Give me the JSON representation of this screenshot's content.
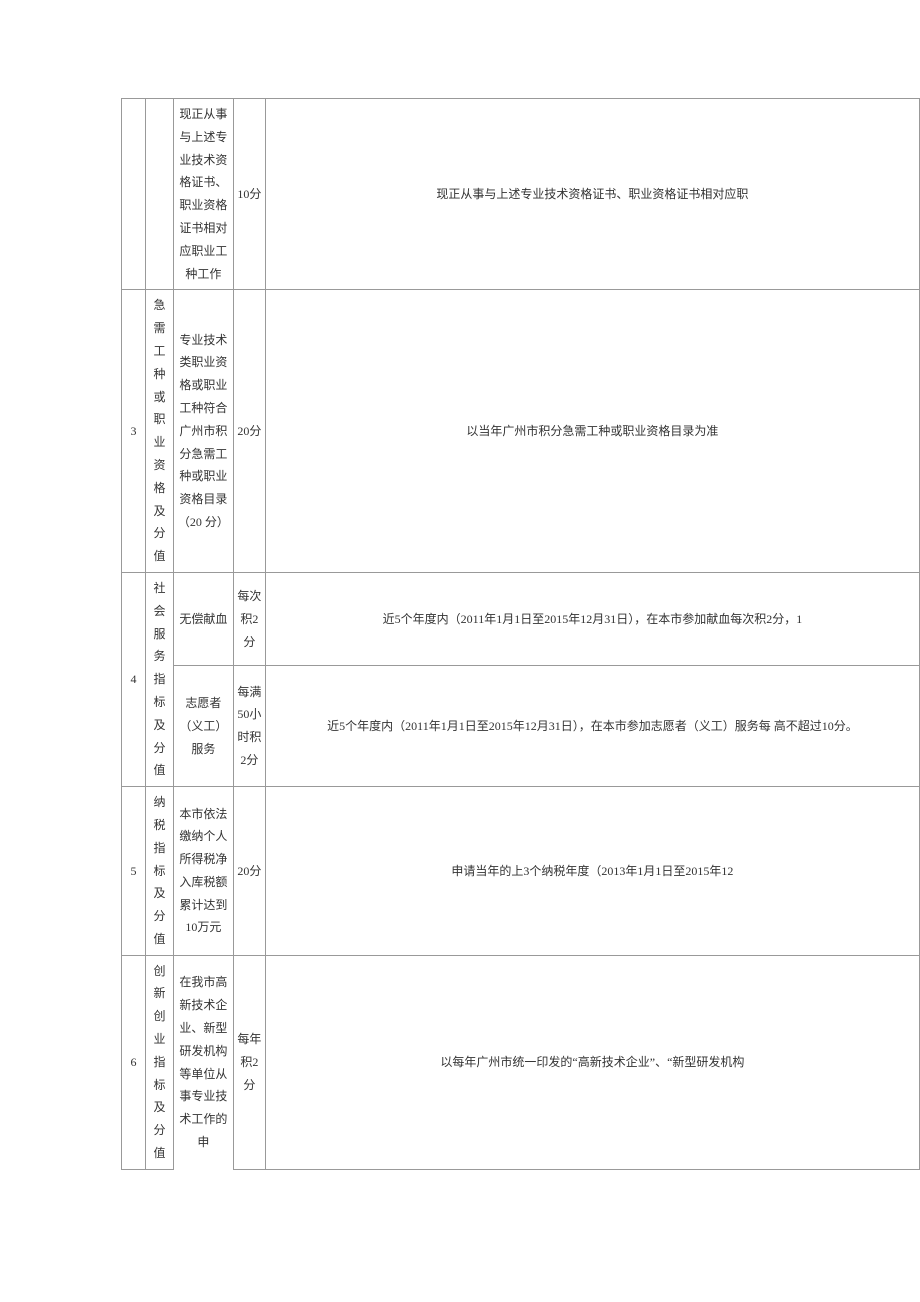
{
  "rows": {
    "r1": {
      "item": "现正从事与上述专业技术资格证书、职业资格证书相对应职业工种工作",
      "score": "10分",
      "desc": "现正从事与上述专业技术资格证书、职业资格证书相对应职"
    },
    "r2": {
      "num": "3",
      "category": "急需工种或职业资格及分值",
      "item": "专业技术类职业资格或职业工种符合广州市积分急需工种或职业资格目录（20 分）",
      "score": "20分",
      "desc": "以当年广州市积分急需工种或职业资格目录为准"
    },
    "r3": {
      "num": "4",
      "category": "社会服务指标及分值",
      "item1": "无偿献血",
      "score1": "每次积2分",
      "desc1": "近5个年度内（2011年1月1日至2015年12月31日），在本市参加献血每次积2分，1",
      "item2": "志愿者（义工）服务",
      "score2": "每满50小时积2分",
      "desc2": "近5个年度内（2011年1月1日至2015年12月31日），在本市参加志愿者（义工）服务每 高不超过10分。"
    },
    "r4": {
      "num": "5",
      "category": "纳税指标及分值",
      "item": "本市依法缴纳个人所得税净入库税额累计达到10万元",
      "score": "20分",
      "desc": "申请当年的上3个纳税年度（2013年1月1日至2015年12"
    },
    "r5": {
      "num": "6",
      "category": "创新创业指标及分值",
      "item": "在我市高新技术企业、新型研发机构等单位从事专业技术工作的申",
      "score": "每年积2分",
      "desc": "以每年广州市统一印发的“高新技术企业”、“新型研发机构"
    }
  }
}
